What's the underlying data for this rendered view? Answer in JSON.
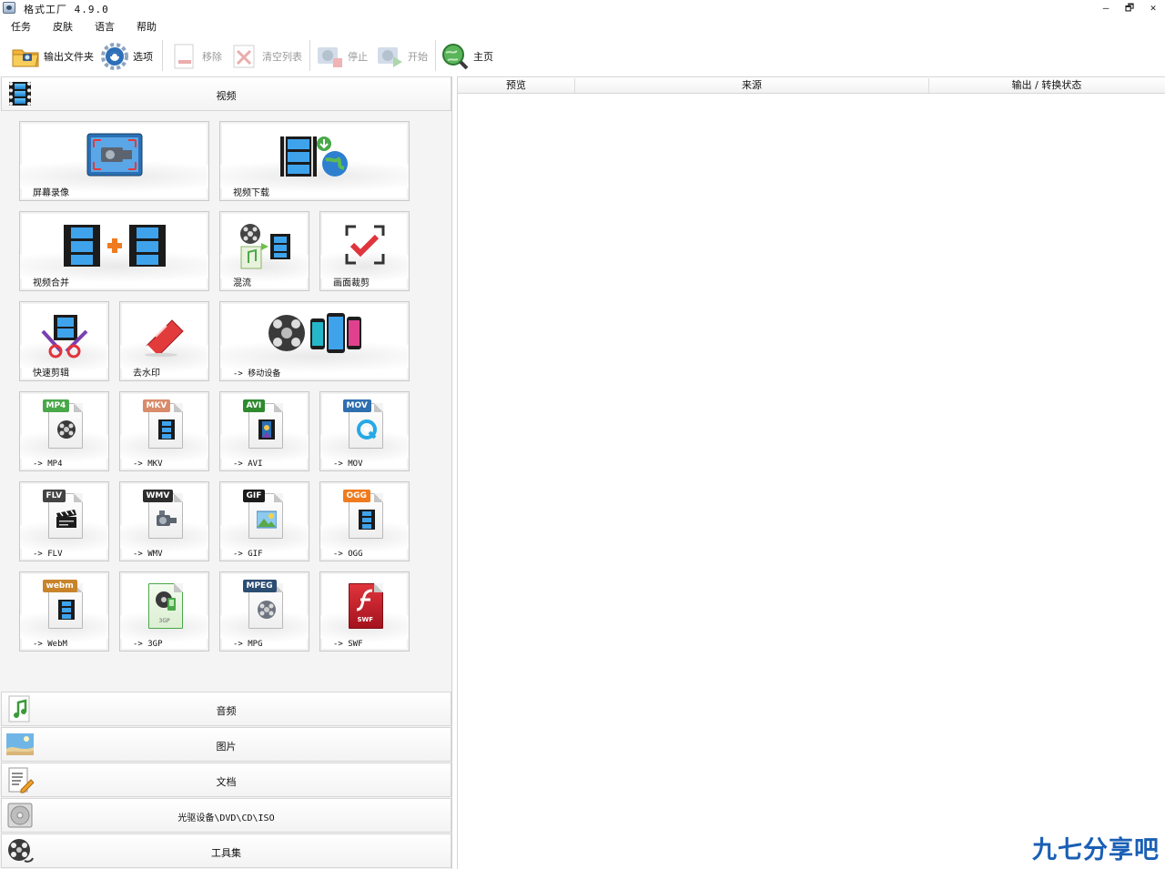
{
  "window": {
    "title": "格式工厂 4.9.0",
    "controls": {
      "minimize": "‒",
      "restore": "🗗",
      "close": "✕"
    }
  },
  "menu": [
    "任务",
    "皮肤",
    "语言",
    "帮助"
  ],
  "toolbar": {
    "output_folder": "输出文件夹",
    "options": "选项",
    "remove": "移除",
    "clear_list": "清空列表",
    "stop": "停止",
    "start": "开始",
    "home": "主页"
  },
  "categories": {
    "video": "视频",
    "audio": "音频",
    "image": "图片",
    "document": "文档",
    "disc": "光驱设备\\DVD\\CD\\ISO",
    "tools": "工具集"
  },
  "tiles": {
    "screen_record": "屏幕录像",
    "video_download": "视频下载",
    "video_merge": "视频合并",
    "mux": "混流",
    "crop": "画面裁剪",
    "quick_clip": "快速剪辑",
    "remove_watermark": "去水印",
    "mobile": "-> 移动设备",
    "mp4": "-> MP4",
    "mkv": "-> MKV",
    "avi": "-> AVI",
    "mov": "-> MOV",
    "flv": "-> FLV",
    "wmv": "-> WMV",
    "gif": "-> GIF",
    "ogg": "-> OGG",
    "webm": "-> WebM",
    "3gp": "-> 3GP",
    "mpg": "-> MPG",
    "swf": "-> SWF"
  },
  "badges": {
    "mp4": "MP4",
    "mkv": "MKV",
    "avi": "AVI",
    "mov": "MOV",
    "flv": "FLV",
    "wmv": "WMV",
    "gif": "GIF",
    "ogg": "OGG",
    "webm": "webm",
    "3gp": "3GP",
    "mpeg": "MPEG",
    "swf": "SWF"
  },
  "task_table": {
    "columns": [
      "预览",
      "来源",
      "输出 / 转换状态"
    ]
  },
  "watermark": "九七分享吧",
  "colors": {
    "mp4": "#4aa84a",
    "mkv": "#d98b6a",
    "avi": "#2f8a2f",
    "mov": "#2f6fb0",
    "flv": "#444444",
    "wmv": "#2d2d2d",
    "gif": "#1c1c1c",
    "ogg": "#f07b1e",
    "webm": "#c8842a",
    "mpeg": "#2d4e73",
    "swf": "#c4182a",
    "brand": "#1a5fb4"
  }
}
